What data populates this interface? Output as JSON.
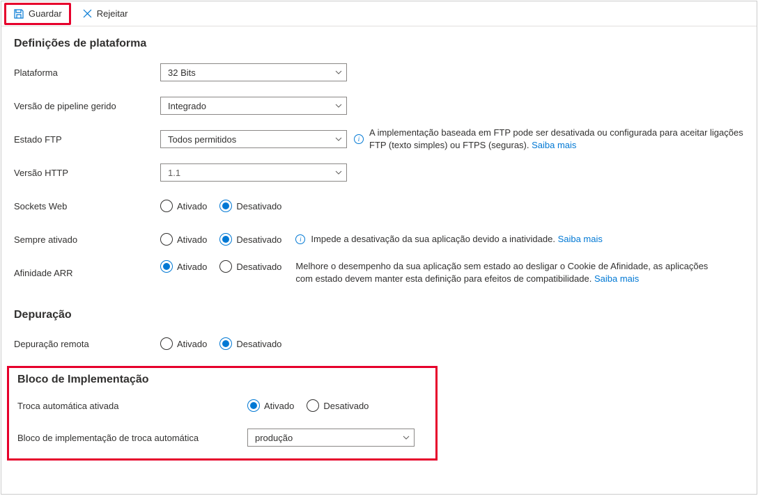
{
  "toolbar": {
    "save_label": "Guardar",
    "discard_label": "Rejeitar"
  },
  "sections": {
    "platform": {
      "title": "Definições de plataforma",
      "platform_label": "Plataforma",
      "platform_value": "32 Bits",
      "pipeline_label": "Versão de pipeline gerido",
      "pipeline_value": "Integrado",
      "ftp_label": "Estado FTP",
      "ftp_value": "Todos permitidos",
      "ftp_info": "A implementação baseada em FTP pode ser desativada ou configurada para aceitar ligações FTP (texto simples) ou FTPS (seguras). ",
      "http_label": "Versão HTTP",
      "http_value": "1.1",
      "sockets_label": "Sockets Web",
      "alwayson_label": "Sempre ativado",
      "alwayson_info": "Impede a desativação da sua aplicação devido a inatividade. ",
      "arr_label": "Afinidade ARR",
      "arr_info": "Melhore o desempenho da sua aplicação sem estado ao desligar o Cookie de Afinidade, as aplicações com estado devem manter esta definição para efeitos de compatibilidade. "
    },
    "debug": {
      "title": "Depuração",
      "remote_label": "Depuração remota"
    },
    "slot": {
      "title": "Bloco de Implementação",
      "autoswap_label": "Troca automática ativada",
      "autoswap_slot_label": "Bloco de implementação de troca automática",
      "autoswap_slot_value": "produção"
    }
  },
  "radio": {
    "on": "Ativado",
    "off": "Desativado"
  },
  "link": {
    "learn_more": "Saiba mais"
  }
}
